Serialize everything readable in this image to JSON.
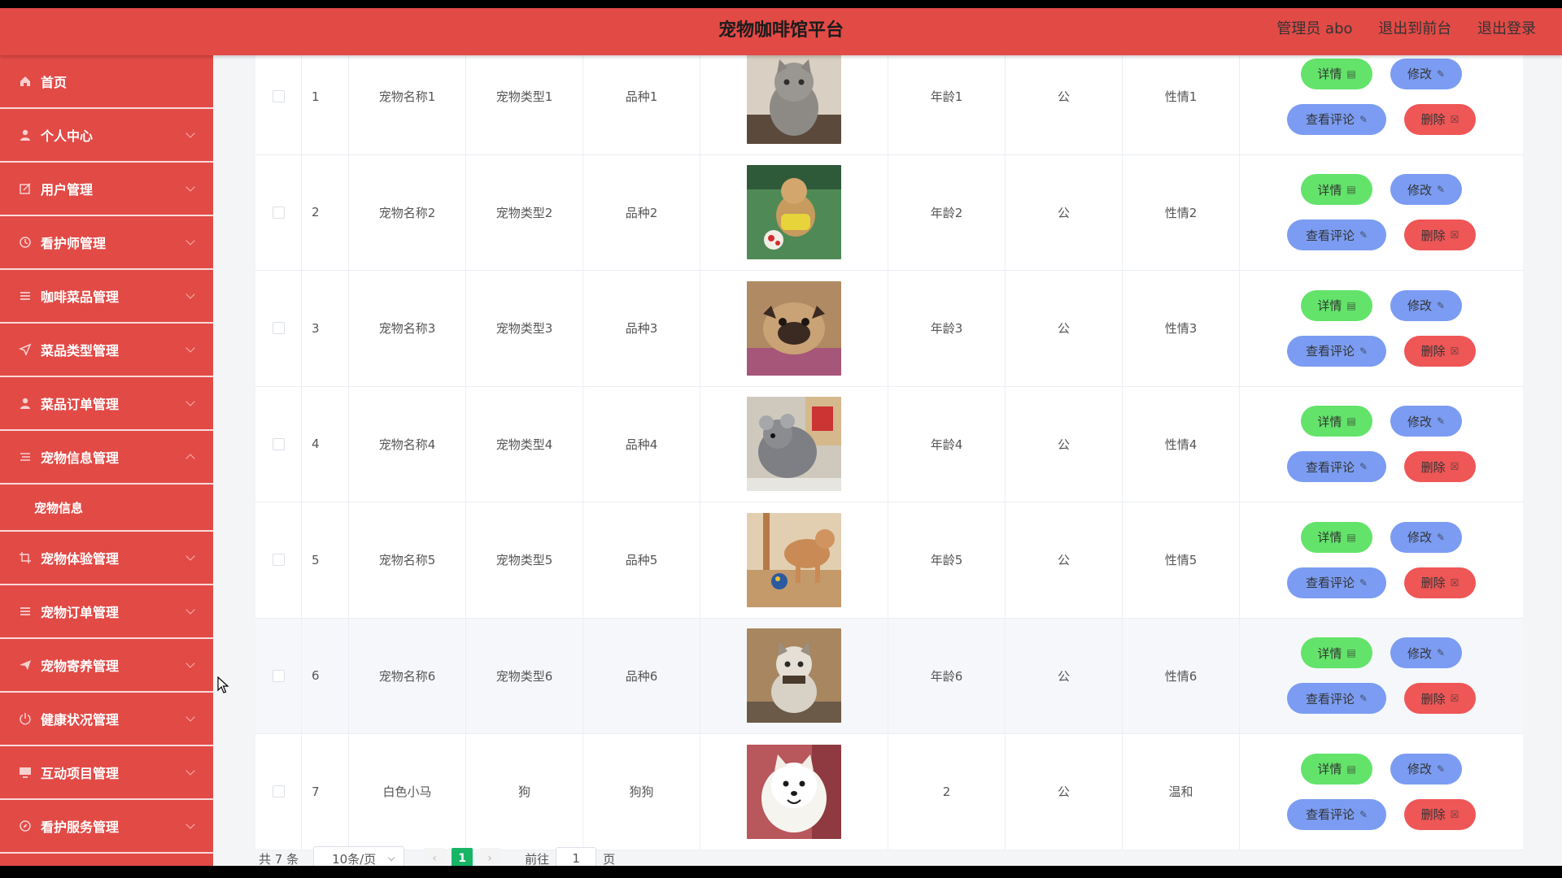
{
  "header": {
    "title": "宠物咖啡馆平台",
    "admin": "管理员 abo",
    "to_front": "退出到前台",
    "logout": "退出登录"
  },
  "sidebar": {
    "items": [
      {
        "label": "首页",
        "icon": "home-icon",
        "expandable": false
      },
      {
        "label": "个人中心",
        "icon": "user-icon",
        "expandable": true
      },
      {
        "label": "用户管理",
        "icon": "edit-icon",
        "expandable": true
      },
      {
        "label": "看护师管理",
        "icon": "clock-icon",
        "expandable": true
      },
      {
        "label": "咖啡菜品管理",
        "icon": "list-icon",
        "expandable": true
      },
      {
        "label": "菜品类型管理",
        "icon": "location-icon",
        "expandable": true
      },
      {
        "label": "菜品订单管理",
        "icon": "user-icon",
        "expandable": true
      },
      {
        "label": "宠物信息管理",
        "icon": "menu-icon",
        "expandable": true,
        "open": true
      },
      {
        "label": "宠物体验管理",
        "icon": "crop-icon",
        "expandable": true
      },
      {
        "label": "宠物订单管理",
        "icon": "list-icon",
        "expandable": true
      },
      {
        "label": "宠物寄养管理",
        "icon": "send-icon",
        "expandable": true
      },
      {
        "label": "健康状况管理",
        "icon": "power-icon",
        "expandable": true
      },
      {
        "label": "互动项目管理",
        "icon": "monitor-icon",
        "expandable": true
      },
      {
        "label": "看护服务管理",
        "icon": "compass-icon",
        "expandable": true
      }
    ],
    "sub_items": [
      "宠物信息"
    ]
  },
  "actions": {
    "detail": "详情",
    "edit": "修改",
    "comment": "查看评论",
    "delete": "删除"
  },
  "rows": [
    {
      "index": "1",
      "name": "宠物名称1",
      "type": "宠物类型1",
      "breed": "品种1",
      "age": "年龄1",
      "sex": "公",
      "temperament": "性情1",
      "photo": "cat-grey"
    },
    {
      "index": "2",
      "name": "宠物名称2",
      "type": "宠物类型2",
      "breed": "品种2",
      "age": "年龄2",
      "sex": "公",
      "temperament": "性情2",
      "photo": "dog-ball-grass"
    },
    {
      "index": "3",
      "name": "宠物名称3",
      "type": "宠物类型3",
      "breed": "品种3",
      "age": "年龄3",
      "sex": "公",
      "temperament": "性情3",
      "photo": "pug"
    },
    {
      "index": "4",
      "name": "宠物名称4",
      "type": "宠物类型4",
      "breed": "品种4",
      "age": "年龄4",
      "sex": "公",
      "temperament": "性情4",
      "photo": "chinchilla"
    },
    {
      "index": "5",
      "name": "宠物名称5",
      "type": "宠物类型5",
      "breed": "品种5",
      "age": "年龄5",
      "sex": "公",
      "temperament": "性情5",
      "photo": "dog-ball-floor"
    },
    {
      "index": "6",
      "name": "宠物名称6",
      "type": "宠物类型6",
      "breed": "品种6",
      "age": "年龄6",
      "sex": "公",
      "temperament": "性情6",
      "photo": "cat-sitting"
    },
    {
      "index": "7",
      "name": "白色小马",
      "type": "狗",
      "breed": "狗狗",
      "age": "2",
      "sex": "公",
      "temperament": "温和",
      "photo": "samoyed"
    }
  ],
  "pagination": {
    "total": "共 7 条",
    "page_size": "10条/页",
    "current": "1",
    "goto_prefix": "前往",
    "goto_value": "1",
    "goto_suffix": "页"
  },
  "colors": {
    "brand": "#e24a46",
    "detail_btn": "#63e36a",
    "edit_btn": "#7b9cf2",
    "delete_btn": "#ef5656",
    "page_active": "#18b566"
  }
}
